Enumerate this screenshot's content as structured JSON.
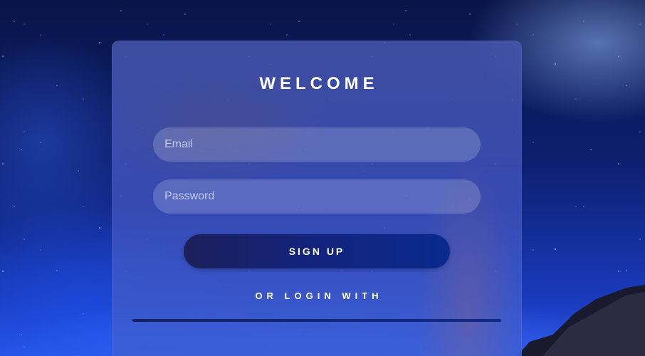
{
  "form": {
    "title": "WELCOME",
    "email": {
      "value": "",
      "placeholder": "Email"
    },
    "password": {
      "value": "",
      "placeholder": "Password"
    },
    "signup_label": "SIGN UP",
    "alt_login_text": "OR LOGIN WITH"
  },
  "colors": {
    "button": "#0a2a8e",
    "divider": "#0f2a86",
    "text": "#ffffff"
  }
}
